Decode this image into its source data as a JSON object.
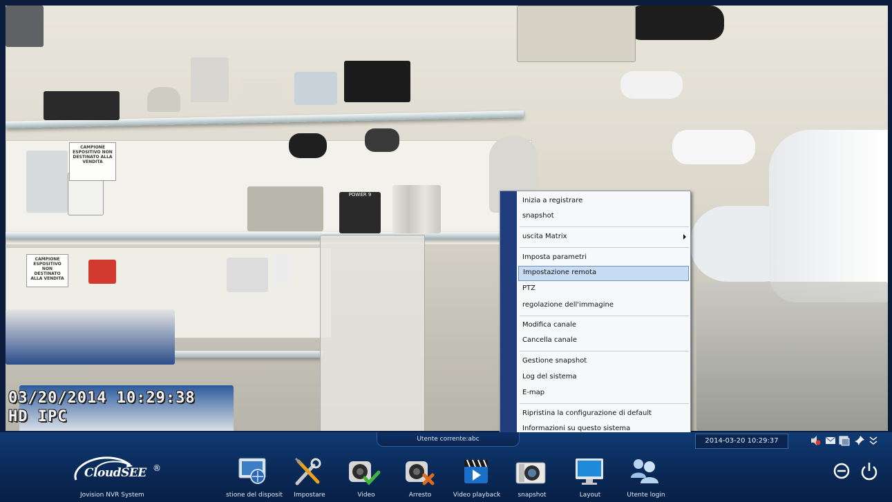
{
  "video": {
    "osd_datetime": "03/20/2014 10:29:38",
    "osd_label": "HD IPC",
    "sign1": "CAMPIONE ESPOSITIVO NON DESTINATO ALLA VENDITA",
    "sign2": "CAMPIONE ESPOSITIVO NON DESTINATO ALLA VENDITA",
    "box_label": "POWER 9"
  },
  "context_menu": {
    "items": [
      {
        "label": "Inizia a registrare"
      },
      {
        "label": "snapshot"
      },
      {
        "label": "uscita Matrix",
        "submenu": true
      },
      {
        "label": "Imposta parametri"
      },
      {
        "label": "Impostazione remota",
        "highlighted": true
      },
      {
        "label": "PTZ"
      },
      {
        "label": "regolazione dell'immagine"
      },
      {
        "label": "Modifica canale"
      },
      {
        "label": "Cancella canale"
      },
      {
        "label": "Gestione snapshot"
      },
      {
        "label": "Log del sistema"
      },
      {
        "label": "E-map"
      },
      {
        "label": "Ripristina la configurazione di default"
      },
      {
        "label": "Informazioni su questo sistema"
      }
    ]
  },
  "status": {
    "current_user": "Utente corrente:abc",
    "datetime": "2014-03-20 10:29:37"
  },
  "brand": {
    "logo": "CloudSEE",
    "reg": "®",
    "system_name": "Jovision NVR System"
  },
  "toolbar": [
    {
      "label": "stione del disposit",
      "icon": "device-management-icon"
    },
    {
      "label": "Impostare",
      "icon": "settings-tools-icon"
    },
    {
      "label": "Video",
      "icon": "video-start-icon"
    },
    {
      "label": "Arresto",
      "icon": "video-stop-icon"
    },
    {
      "label": "Video playback",
      "icon": "playback-icon"
    },
    {
      "label": "snapshot",
      "icon": "camera-icon"
    },
    {
      "label": "Layout",
      "icon": "monitor-icon"
    },
    {
      "label": "Utente login",
      "icon": "users-icon"
    }
  ],
  "colors": {
    "bar": "#0a2a58",
    "menu_rail": "#1e3d7a",
    "menu_highlight": "#c7dcf3"
  }
}
